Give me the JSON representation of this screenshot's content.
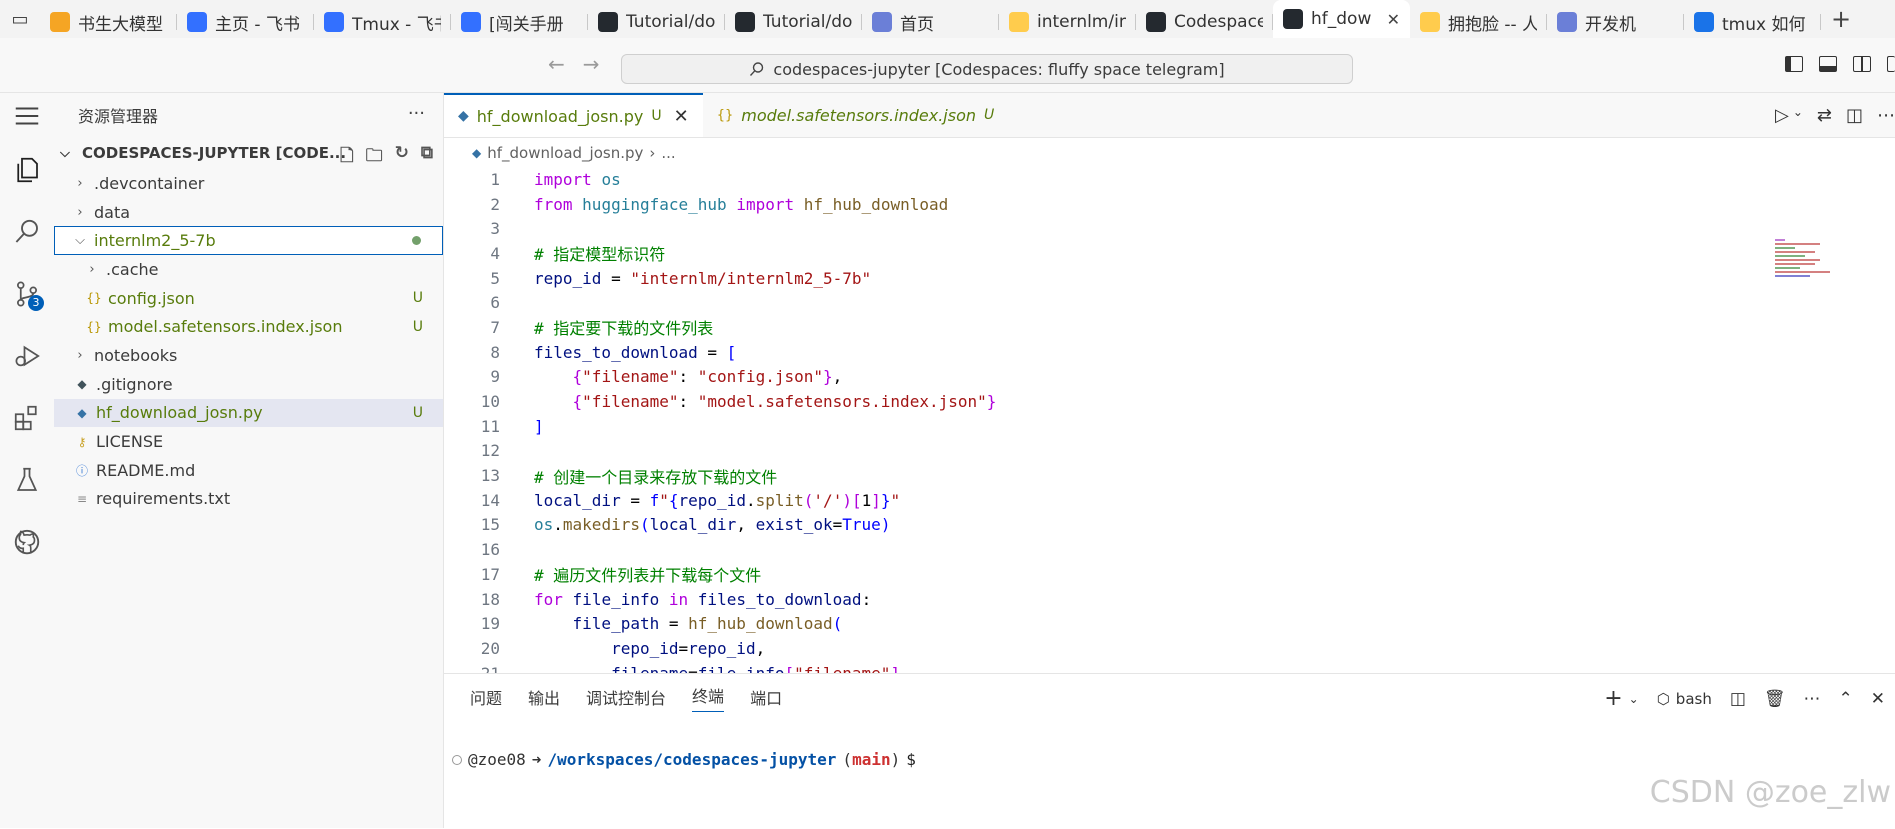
{
  "browser": {
    "tabs": [
      {
        "title": "书生大模型",
        "icon": "orange-bolt-icon",
        "color": "#f5a524"
      },
      {
        "title": "主页 - 飞书",
        "icon": "feishu-icon",
        "color": "#3370ff"
      },
      {
        "title": "Tmux - 飞书",
        "icon": "doc-icon",
        "color": "#3370ff"
      },
      {
        "title": "[闯关手册",
        "icon": "doc-icon",
        "color": "#3370ff"
      },
      {
        "title": "Tutorial/do",
        "icon": "github-icon",
        "color": "#24292f"
      },
      {
        "title": "Tutorial/do",
        "icon": "github-icon",
        "color": "#24292f"
      },
      {
        "title": "首页",
        "icon": "robot-icon",
        "color": "#6b7fd7"
      },
      {
        "title": "internlm/in",
        "icon": "hf-icon",
        "color": "#ffcc4d"
      },
      {
        "title": "Codespace",
        "icon": "github-icon",
        "color": "#24292f"
      },
      {
        "title": "hf_dow",
        "icon": "github-icon",
        "color": "#24292f",
        "active": true
      },
      {
        "title": "拥抱脸 -- 人",
        "icon": "hf-icon",
        "color": "#ffcc4d"
      },
      {
        "title": "开发机",
        "icon": "robot-icon",
        "color": "#6b7fd7"
      },
      {
        "title": "tmux 如何",
        "icon": "blue-circle-icon",
        "color": "#1a73e8"
      }
    ],
    "new_tab": "+"
  },
  "titlebar": {
    "command_center": "codespaces-jupyter [Codespaces: fluffy space telegram]"
  },
  "activity": {
    "scm_badge": "3"
  },
  "sidebar": {
    "title": "资源管理器",
    "more": "···",
    "root": "CODESPACES-JUPYTER [CODE...",
    "items": [
      {
        "label": ".devcontainer",
        "type": "folder",
        "depth": 0
      },
      {
        "label": "data",
        "type": "folder",
        "depth": 0
      },
      {
        "label": "internlm2_5-7b",
        "type": "folder-open",
        "depth": 0,
        "status": "dot"
      },
      {
        "label": ".cache",
        "type": "folder",
        "depth": 1
      },
      {
        "label": "config.json",
        "type": "json",
        "depth": 1,
        "status": "U"
      },
      {
        "label": "model.safetensors.index.json",
        "type": "json",
        "depth": 1,
        "status": "U"
      },
      {
        "label": "notebooks",
        "type": "folder",
        "depth": 0
      },
      {
        "label": ".gitignore",
        "type": "git",
        "depth": 0
      },
      {
        "label": "hf_download_josn.py",
        "type": "py",
        "depth": 0,
        "status": "U"
      },
      {
        "label": "LICENSE",
        "type": "license",
        "depth": 0
      },
      {
        "label": "README.md",
        "type": "info",
        "depth": 0
      },
      {
        "label": "requirements.txt",
        "type": "txt",
        "depth": 0
      }
    ]
  },
  "editor": {
    "tabs": [
      {
        "label": "hf_download_josn.py",
        "status": "U",
        "active": true
      },
      {
        "label": "model.safetensors.index.json",
        "status": "U",
        "active": false
      }
    ],
    "breadcrumb": [
      "hf_download_josn.py",
      "..."
    ],
    "lines": [
      {
        "n": "1",
        "tokens": [
          [
            "kw",
            "import"
          ],
          [
            "plain",
            " "
          ],
          [
            "mod",
            "os"
          ]
        ]
      },
      {
        "n": "2",
        "tokens": [
          [
            "kw",
            "from"
          ],
          [
            "plain",
            " "
          ],
          [
            "mod",
            "huggingface_hub"
          ],
          [
            "plain",
            " "
          ],
          [
            "kw",
            "import"
          ],
          [
            "plain",
            " "
          ],
          [
            "fn",
            "hf_hub_download"
          ]
        ]
      },
      {
        "n": "3",
        "tokens": []
      },
      {
        "n": "4",
        "tokens": [
          [
            "cm",
            "# 指定模型标识符"
          ]
        ]
      },
      {
        "n": "5",
        "tokens": [
          [
            "var",
            "repo_id"
          ],
          [
            "plain",
            " = "
          ],
          [
            "str",
            "\"internlm/internlm2_5-7b\""
          ]
        ]
      },
      {
        "n": "6",
        "tokens": []
      },
      {
        "n": "7",
        "tokens": [
          [
            "cm",
            "# 指定要下载的文件列表"
          ]
        ]
      },
      {
        "n": "8",
        "tokens": [
          [
            "var",
            "files_to_download"
          ],
          [
            "plain",
            " = "
          ],
          [
            "kw2",
            "["
          ]
        ]
      },
      {
        "n": "9",
        "tokens": [
          [
            "plain",
            "    "
          ],
          [
            "kw",
            "{"
          ],
          [
            "str",
            "\"filename\""
          ],
          [
            "plain",
            ": "
          ],
          [
            "str",
            "\"config.json\""
          ],
          [
            "kw",
            "}"
          ],
          [
            "plain",
            ","
          ]
        ]
      },
      {
        "n": "10",
        "tokens": [
          [
            "plain",
            "    "
          ],
          [
            "kw",
            "{"
          ],
          [
            "str",
            "\"filename\""
          ],
          [
            "plain",
            ": "
          ],
          [
            "str",
            "\"model.safetensors.index.json\""
          ],
          [
            "kw",
            "}"
          ]
        ]
      },
      {
        "n": "11",
        "tokens": [
          [
            "kw2",
            "]"
          ]
        ]
      },
      {
        "n": "12",
        "tokens": []
      },
      {
        "n": "13",
        "tokens": [
          [
            "cm",
            "# 创建一个目录来存放下载的文件"
          ]
        ]
      },
      {
        "n": "14",
        "tokens": [
          [
            "var",
            "local_dir"
          ],
          [
            "plain",
            " = "
          ],
          [
            "kw2",
            "f"
          ],
          [
            "str",
            "\""
          ],
          [
            "kw2",
            "{"
          ],
          [
            "var",
            "repo_id"
          ],
          [
            "plain",
            "."
          ],
          [
            "fn",
            "split"
          ],
          [
            "kw",
            "("
          ],
          [
            "str",
            "'/'"
          ],
          [
            "kw",
            ")"
          ],
          [
            "kw",
            "["
          ],
          [
            "plain",
            "1"
          ],
          [
            "kw",
            "]"
          ],
          [
            "kw2",
            "}"
          ],
          [
            "str",
            "\""
          ]
        ]
      },
      {
        "n": "15",
        "tokens": [
          [
            "mod",
            "os"
          ],
          [
            "plain",
            "."
          ],
          [
            "fn",
            "makedirs"
          ],
          [
            "kw2",
            "("
          ],
          [
            "var",
            "local_dir"
          ],
          [
            "plain",
            ", "
          ],
          [
            "var",
            "exist_ok"
          ],
          [
            "plain",
            "="
          ],
          [
            "kw2",
            "True"
          ],
          [
            "kw2",
            ")"
          ]
        ]
      },
      {
        "n": "16",
        "tokens": []
      },
      {
        "n": "17",
        "tokens": [
          [
            "cm",
            "# 遍历文件列表并下载每个文件"
          ]
        ]
      },
      {
        "n": "18",
        "tokens": [
          [
            "kw",
            "for"
          ],
          [
            "plain",
            " "
          ],
          [
            "var",
            "file_info"
          ],
          [
            "plain",
            " "
          ],
          [
            "kw",
            "in"
          ],
          [
            "plain",
            " "
          ],
          [
            "var",
            "files_to_download"
          ],
          [
            "plain",
            ":"
          ]
        ]
      },
      {
        "n": "19",
        "tokens": [
          [
            "plain",
            "    "
          ],
          [
            "var",
            "file_path"
          ],
          [
            "plain",
            " = "
          ],
          [
            "fn",
            "hf_hub_download"
          ],
          [
            "kw2",
            "("
          ]
        ]
      },
      {
        "n": "20",
        "tokens": [
          [
            "plain",
            "        "
          ],
          [
            "var",
            "repo_id"
          ],
          [
            "plain",
            "="
          ],
          [
            "var",
            "repo_id"
          ],
          [
            "plain",
            ","
          ]
        ]
      },
      {
        "n": "21",
        "tokens": [
          [
            "plain",
            "        "
          ],
          [
            "var",
            "filename"
          ],
          [
            "plain",
            "="
          ],
          [
            "var",
            "file_info"
          ],
          [
            "kw",
            "["
          ],
          [
            "str",
            "\"filename\""
          ],
          [
            "kw",
            "]"
          ]
        ]
      }
    ]
  },
  "panel": {
    "tabs": [
      "问题",
      "输出",
      "调试控制台",
      "终端",
      "端口"
    ],
    "active_tab": "终端",
    "shell": "bash",
    "terminal": {
      "user": "@zoe08",
      "arrow": "➜",
      "path": "/workspaces/codespaces-jupyter",
      "branch_open": "(",
      "branch": "main",
      "branch_close": ")",
      "prompt": "$"
    }
  },
  "watermark": "CSDN @zoe_zlw"
}
